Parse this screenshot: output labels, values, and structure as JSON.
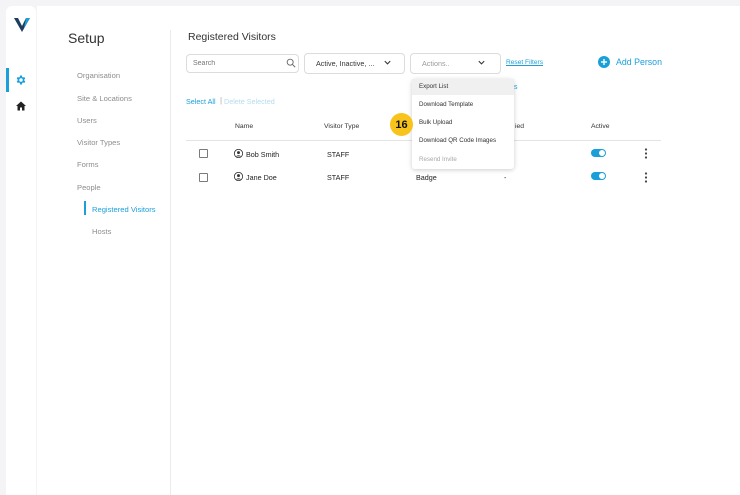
{
  "app": {
    "colors": {
      "accent": "#1a9fd9",
      "badge": "#f8c31b"
    }
  },
  "rail": {
    "items": [
      {
        "icon": "gear-icon",
        "active": true
      },
      {
        "icon": "home-icon",
        "active": false
      }
    ]
  },
  "setup": {
    "title": "Setup",
    "nav": [
      {
        "label": "Organisation"
      },
      {
        "label": "Site & Locations"
      },
      {
        "label": "Users"
      },
      {
        "label": "Visitor Types"
      },
      {
        "label": "Forms"
      },
      {
        "label": "People"
      },
      {
        "label": "Registered Visitors",
        "active": true
      },
      {
        "label": "Hosts"
      }
    ]
  },
  "main": {
    "title": "Registered Visitors",
    "search_placeholder": "Search",
    "status_filter": "Active, Inactive, ...",
    "actions_placeholder": "Actions..",
    "reset_filters": "Reset Filters",
    "add_person": "Add Person",
    "select_all": "Select All",
    "separator": "|",
    "delete_selected": "Delete Selected",
    "menu_peek": "s"
  },
  "actions_menu": {
    "items": [
      {
        "label": "Export List",
        "state": "hover"
      },
      {
        "label": "Download Template",
        "state": "normal"
      },
      {
        "label": "Bulk Upload",
        "state": "normal"
      },
      {
        "label": "Download QR Code Images",
        "state": "normal"
      },
      {
        "label": "Resend Invite",
        "state": "disabled"
      }
    ],
    "step_badge": "16"
  },
  "table": {
    "columns": {
      "name": "Name",
      "visitor_type": "Visitor Type",
      "partial": "ied",
      "active": "Active"
    },
    "rows": [
      {
        "name": "Bob Smith",
        "visitor_type": "STAFF",
        "credential": "",
        "last": "",
        "active": true
      },
      {
        "name": "Jane Doe",
        "visitor_type": "STAFF",
        "credential": "Badge",
        "last": "-",
        "active": true
      }
    ]
  }
}
